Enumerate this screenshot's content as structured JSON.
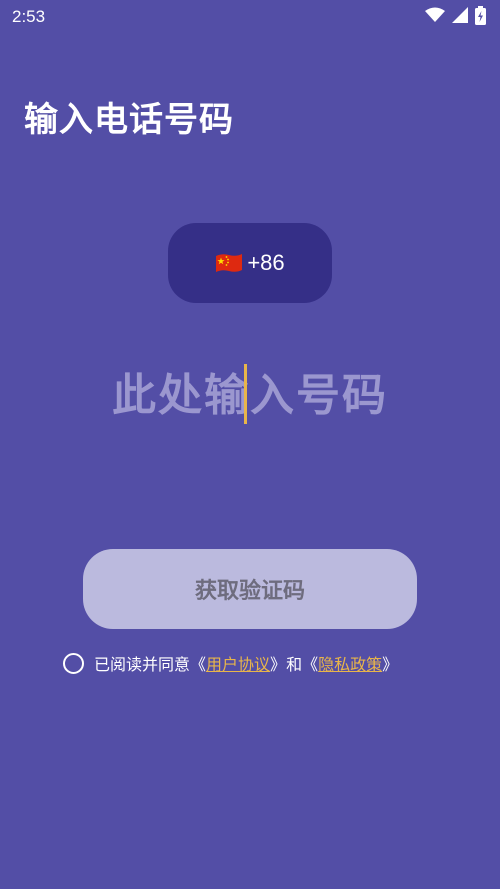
{
  "status_bar": {
    "time": "2:53",
    "icons": [
      "wifi-icon",
      "signal-icon",
      "battery-charging-icon"
    ]
  },
  "page": {
    "title": "输入电话号码"
  },
  "country_selector": {
    "flag": "china-flag-icon",
    "code": "+86"
  },
  "phone_input": {
    "placeholder": "此处输入号码",
    "value": ""
  },
  "get_code_button": {
    "label": "获取验证码"
  },
  "agreement": {
    "prefix": "已阅读并同意",
    "open_quote_1": "《",
    "user_agreement": "用户协议",
    "close_quote_1": "》",
    "conjunction": "和",
    "open_quote_2": "《",
    "privacy_policy": "隐私政策",
    "close_quote_2": "》",
    "checked": false
  },
  "colors": {
    "background": "#534ea6",
    "country_button": "#352f87",
    "placeholder": "#9b97cf",
    "cursor": "#e8b54a",
    "link": "#e8b54a",
    "button_disabled_bg": "#bbbade",
    "button_disabled_text": "#6e6c7e"
  }
}
